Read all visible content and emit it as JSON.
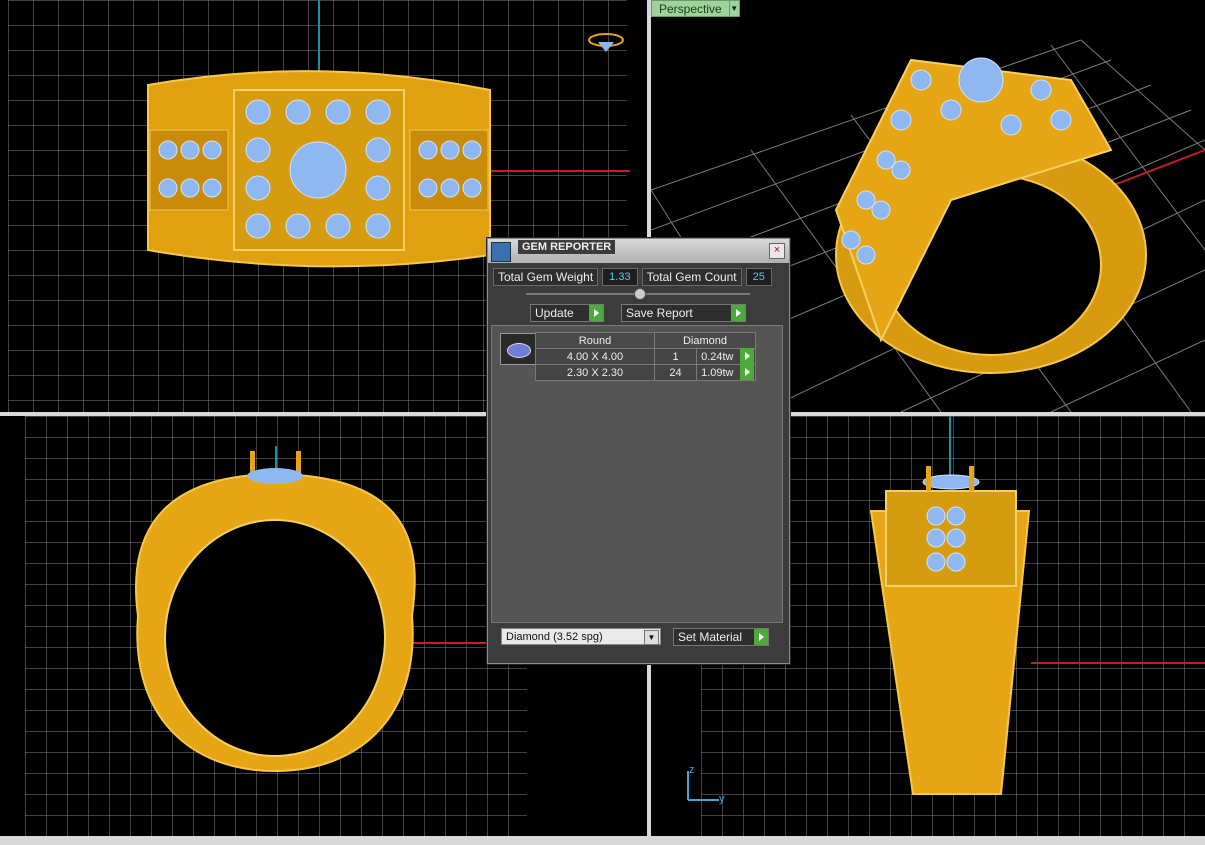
{
  "viewport_label": "Perspective",
  "gem_reporter": {
    "title": "GEM REPORTER",
    "close_icon": "close-icon",
    "total_gem_weight_label": "Total Gem Weight",
    "total_gem_weight_value": "1.33",
    "total_gem_count_label": "Total Gem Count",
    "total_gem_count_value": "25",
    "update_label": "Update",
    "save_report_label": "Save Report",
    "table": {
      "shape": "Round",
      "material": "Diamond",
      "rows": [
        {
          "size": "4.00 X 4.00",
          "count": "1",
          "weight": "0.24tw"
        },
        {
          "size": "2.30 X 2.30",
          "count": "24",
          "weight": "1.09tw"
        }
      ]
    },
    "material_select": "Diamond     (3.52 spg)",
    "set_material_label": "Set Material"
  },
  "axis_labels": {
    "z": "z",
    "y": "y"
  },
  "colors": {
    "gold": "#e6a514",
    "gem": "#8fb8f0",
    "accent_green": "#4caa3a"
  }
}
